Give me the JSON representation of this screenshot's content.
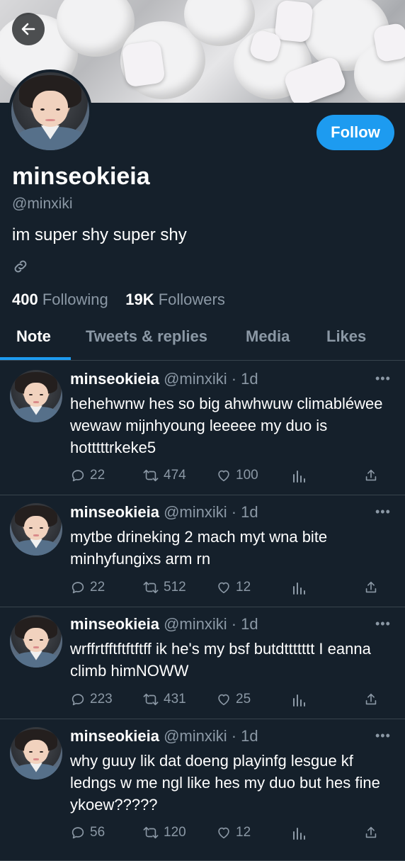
{
  "profile": {
    "display_name": "minseokieia",
    "handle": "@minxiki",
    "bio": "im super shy super shy",
    "following_count": "400",
    "following_label": "Following",
    "followers_count": "19K",
    "followers_label": "Followers",
    "follow_button": "Follow"
  },
  "tabs": [
    {
      "label": "Note"
    },
    {
      "label": "Tweets & replies"
    },
    {
      "label": "Media"
    },
    {
      "label": "Likes"
    }
  ],
  "tweets": [
    {
      "name": "minseokieia",
      "handle_time": "@minxiki · 1d",
      "text": "hehehwnw hes so big ahwhwuw climabléwee wewaw mijnhyoung leeeee my duo is hotttttrkeke5",
      "replies": "22",
      "retweets": "474",
      "likes": "100"
    },
    {
      "name": "minseokieia",
      "handle_time": "@minxiki · 1d",
      "text": "mytbe drineking 2 mach myt wna bite minhyfungixs arm rn",
      "replies": "22",
      "retweets": "512",
      "likes": "12"
    },
    {
      "name": "minseokieia",
      "handle_time": "@minxiki · 1d",
      "text": "wrffrtfftftftftff ik he's my bsf butdttttttt I eanna climb himNOWW",
      "replies": "223",
      "retweets": "431",
      "likes": "25"
    },
    {
      "name": "minseokieia",
      "handle_time": "@minxiki · 1d",
      "text": "why guuy lik dat doeng playinfg lesgue kf ledngs w me ngl like hes my duo but hes fine ykoew?????",
      "replies": "56",
      "retweets": "120",
      "likes": "12"
    }
  ],
  "colors": {
    "background": "#15202b",
    "accent": "#1d9bf0",
    "muted_text": "#8b98a5",
    "divider": "#38444d"
  },
  "icons": [
    "back-arrow-icon",
    "link-icon",
    "reply-icon",
    "retweet-icon",
    "like-icon",
    "analytics-icon",
    "share-icon",
    "more-icon"
  ]
}
